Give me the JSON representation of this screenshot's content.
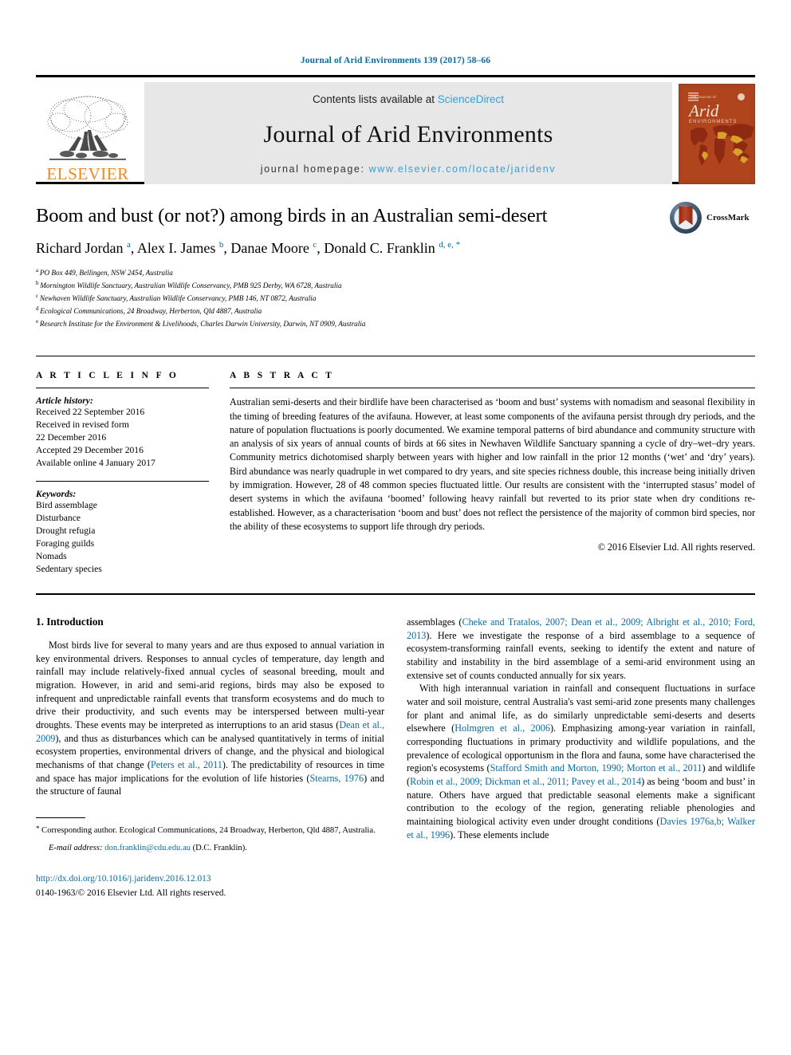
{
  "running_head": "Journal of Arid Environments 139 (2017) 58–66",
  "masthead": {
    "contents_prefix": "Contents lists available at ",
    "sciencedirect": "ScienceDirect",
    "journal_title": "Journal of Arid Environments",
    "homepage_prefix": "journal homepage: ",
    "homepage_url": "www.elsevier.com/locate/jaridenv",
    "publisher": "ELSEVIER",
    "cover": {
      "line1": "The Journal of",
      "line2": "Arid",
      "line3": "ENVIRONMENTS"
    },
    "accent_link_color": "#3a9fd6",
    "band_color": "#e7e7e7",
    "cover_color": "#b0441d",
    "elsevier_orange": "#ee8822"
  },
  "article": {
    "title": "Boom and bust (or not?) among birds in an Australian semi-desert",
    "crossmark_label": "CrossMark",
    "authors": [
      {
        "name": "Richard Jordan",
        "marks": "a",
        "sep": ", "
      },
      {
        "name": "Alex I. James",
        "marks": "b",
        "sep": ", "
      },
      {
        "name": "Danae Moore",
        "marks": "c",
        "sep": ", "
      },
      {
        "name": "Donald C. Franklin",
        "marks": "d, e, *",
        "sep": ""
      }
    ],
    "affiliations": [
      {
        "mark": "a",
        "text": "PO Box 449, Bellingen, NSW 2454, Australia"
      },
      {
        "mark": "b",
        "text": "Mornington Wildlife Sanctuary, Australian Wildlife Conservancy, PMB 925 Derby, WA 6728, Australia"
      },
      {
        "mark": "c",
        "text": "Newhaven Wildlife Sanctuary, Australian Wildlife Conservancy, PMB 146, NT 0872, Australia"
      },
      {
        "mark": "d",
        "text": "Ecological Communications, 24 Broadway, Herberton, Qld 4887, Australia"
      },
      {
        "mark": "e",
        "text": "Research Institute for the Environment & Livelihoods, Charles Darwin University, Darwin, NT 0909, Australia"
      }
    ]
  },
  "info": {
    "heading": "A R T I C L E   I N F O",
    "history_label": "Article history:",
    "history": [
      "Received 22 September 2016",
      "Received in revised form",
      "22 December 2016",
      "Accepted 29 December 2016",
      "Available online 4 January 2017"
    ],
    "keywords_label": "Keywords:",
    "keywords": [
      "Bird assemblage",
      "Disturbance",
      "Drought refugia",
      "Foraging guilds",
      "Nomads",
      "Sedentary species"
    ]
  },
  "abstract": {
    "heading": "A B S T R A C T",
    "text": "Australian semi-deserts and their birdlife have been characterised as ‘boom and bust’ systems with nomadism and seasonal flexibility in the timing of breeding features of the avifauna. However, at least some components of the avifauna persist through dry periods, and the nature of population fluctuations is poorly documented. We examine temporal patterns of bird abundance and community structure with an analysis of six years of annual counts of birds at 66 sites in Newhaven Wildlife Sanctuary spanning a cycle of dry–wet–dry years. Community metrics dichotomised sharply between years with higher and low rainfall in the prior 12 months (‘wet’ and ‘dry’ years). Bird abundance was nearly quadruple in wet compared to dry years, and site species richness double, this increase being initially driven by immigration. However, 28 of 48 common species fluctuated little. Our results are consistent with the ‘interrupted stasus’ model of desert systems in which the avifauna ‘boomed’ following heavy rainfall but reverted to its prior state when dry conditions re-established. However, as a characterisation ‘boom and bust’ does not reflect the persistence of the majority of common bird species, nor the ability of these ecosystems to support life through dry periods.",
    "copyright": "© 2016 Elsevier Ltd. All rights reserved."
  },
  "body": {
    "section_heading": "1. Introduction",
    "left_paragraph_1": "Most birds live for several to many years and are thus exposed to annual variation in key environmental drivers. Responses to annual cycles of temperature, day length and rainfall may include relatively-fixed annual cycles of seasonal breeding, moult and migration. However, in arid and semi-arid regions, birds may also be exposed to infrequent and unpredictable rainfall events that transform ecosystems and do much to drive their productivity, and such events may be interspersed between multi-year droughts. These events may be interpreted as interruptions to an arid stasus (",
    "ref_dean": "Dean et al., 2009",
    "left_paragraph_1b": "), and thus as disturbances which can be analysed quantitatively in terms of initial ecosystem properties, environmental drivers of change, and the physical and biological mechanisms of that change (",
    "ref_peters": "Peters et al., 2011",
    "left_paragraph_1c": "). The predictability of resources in time and space has major implications for the evolution of life histories (",
    "ref_stearns": "Stearns, 1976",
    "left_paragraph_1d": ") and the structure of faunal",
    "right_paragraph_1a": "assemblages (",
    "ref_group1": "Cheke and Tratalos, 2007; Dean et al., 2009; Albright et al., 2010; Ford, 2013",
    "right_paragraph_1b": "). Here we investigate the response of a bird assemblage to a sequence of ecosystem-transforming rainfall events, seeking to identify the extent and nature of stability and instability in the bird assemblage of a semi-arid environment using an extensive set of counts conducted annually for six years.",
    "right_paragraph_2a": "With high interannual variation in rainfall and consequent fluctuations in surface water and soil moisture, central Australia's vast semi-arid zone presents many challenges for plant and animal life, as do similarly unpredictable semi-deserts and deserts elsewhere (",
    "ref_holmgren": "Holmgren et al., 2006",
    "right_paragraph_2b": "). Emphasizing among-year variation in rainfall, corresponding fluctuations in primary productivity and wildlife populations, and the prevalence of ecological opportunism in the flora and fauna, some have characterised the region's ecosystems (",
    "ref_stafford": "Stafford Smith and Morton, 1990; Morton et al., 2011",
    "right_paragraph_2c": ") and wildlife (",
    "ref_robin": "Robin et al., 2009; Dickman et al., 2011; Pavey et al., 2014",
    "right_paragraph_2d": ") as being ‘boom and bust’ in nature. Others have argued that predictable seasonal elements make a significant contribution to the ecology of the region, generating reliable phenologies and maintaining biological activity even under drought conditions (",
    "ref_davies": "Davies 1976a,b; Walker et al., 1996",
    "right_paragraph_2e": "). These elements include"
  },
  "footnote": {
    "star": "*",
    "corresponding": " Corresponding author. Ecological Communications, 24 Broadway, Herberton, Qld 4887, Australia.",
    "email_label": "E-mail address:",
    "email": "don.franklin@cdu.edu.au",
    "email_suffix": " (D.C. Franklin).",
    "doi": "http://dx.doi.org/10.1016/j.jaridenv.2016.12.013",
    "issn": "0140-1963/© 2016 Elsevier Ltd. All rights reserved.",
    "link_color": "#0b6aa2"
  }
}
